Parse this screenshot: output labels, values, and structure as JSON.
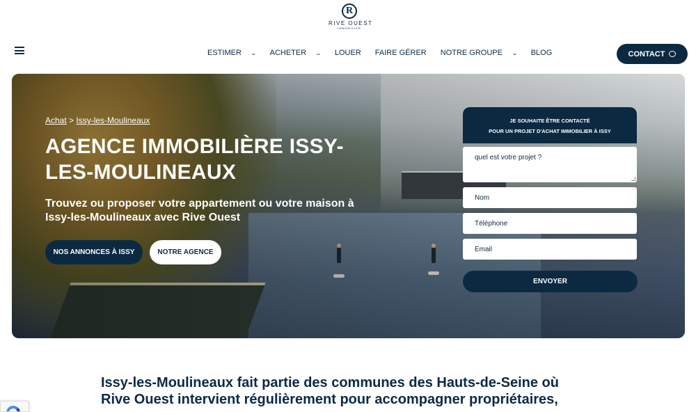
{
  "brand": {
    "mark": "R",
    "name": "RIVE OUEST",
    "sub": "IMMOBILIER"
  },
  "nav": {
    "items": [
      {
        "label": "ESTIMER",
        "dropdown": true
      },
      {
        "label": "ACHETER",
        "dropdown": true
      },
      {
        "label": "LOUER",
        "dropdown": false
      },
      {
        "label": "FAIRE GÉRER",
        "dropdown": false
      },
      {
        "label": "NOTRE GROUPE",
        "dropdown": true
      },
      {
        "label": "BLOG",
        "dropdown": false
      }
    ],
    "contact_label": "CONTACT",
    "menu_icon": "hamburger-icon"
  },
  "hero": {
    "breadcrumb": {
      "root": "Achat",
      "separator": ">",
      "current": "Issy-les-Moulineaux"
    },
    "title": "AGENCE IMMOBILIÈRE ISSY-LES-MOULINEAUX",
    "subtitle": "Trouvez ou proposer votre appartement ou votre maison à Issy-les-Moulineaux avec Rive Ouest",
    "btn_primary": "NOS ANNONCES À ISSY",
    "btn_secondary": "NOTRE AGENCE"
  },
  "form": {
    "heading_line1": "JE SOUHAITE ÊTRE CONTACTÉ",
    "heading_line2": "POUR UN PROJET D'ACHAT IMMOBILIER À ISSY",
    "project_placeholder": "quel est votre projet ?",
    "name_placeholder": "Nom",
    "phone_placeholder": "Téléphone",
    "email_placeholder": "Email",
    "submit": "ENVOYER"
  },
  "intro": "Issy-les-Moulineaux fait partie des communes des Hauts-de-Seine où Rive Ouest intervient régulièrement pour accompagner propriétaires,",
  "colors": {
    "primary": "#0b2a42",
    "text": "#0c2a44",
    "white": "#ffffff"
  }
}
